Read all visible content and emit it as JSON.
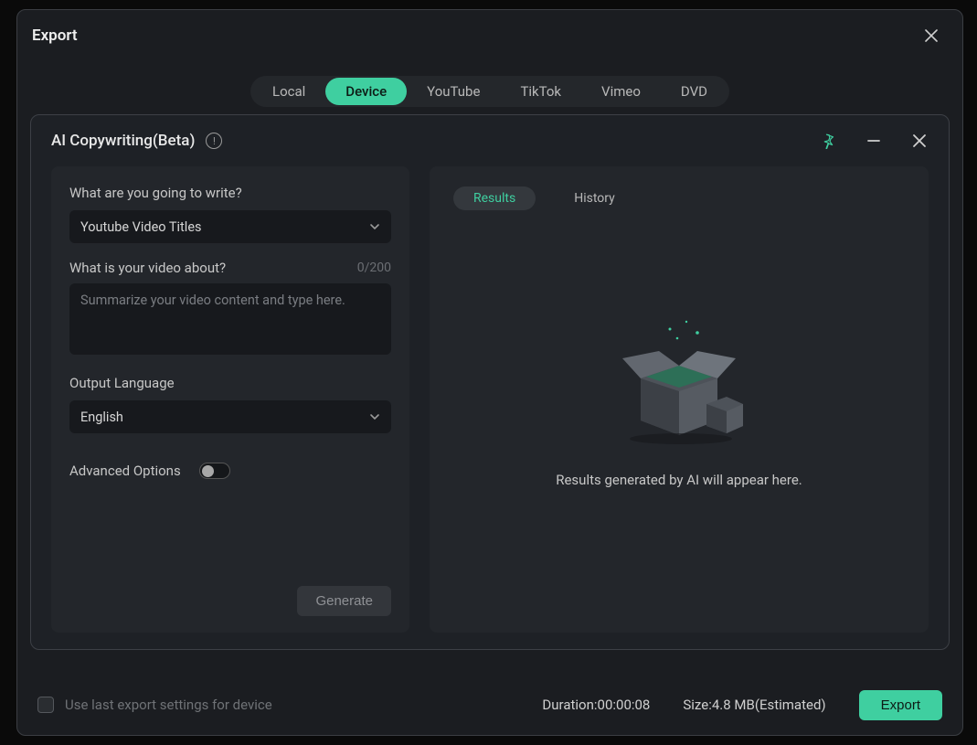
{
  "outer": {
    "title": "Export",
    "tabs": [
      "Local",
      "Device",
      "YouTube",
      "TikTok",
      "Vimeo",
      "DVD"
    ],
    "active_tab": "Device"
  },
  "inner": {
    "title": "AI Copywriting(Beta)"
  },
  "form": {
    "write_label": "What are you going to write?",
    "write_value": "Youtube Video Titles",
    "about_label": "What is your video about?",
    "about_counter": "0/200",
    "about_placeholder": "Summarize your video content and type here.",
    "lang_label": "Output Language",
    "lang_value": "English",
    "advanced_label": "Advanced Options",
    "generate_label": "Generate"
  },
  "results": {
    "tab_results": "Results",
    "tab_history": "History",
    "empty_text": "Results generated by AI will appear here."
  },
  "footer": {
    "checkbox_label": "Use last export settings for device",
    "duration_label": "Duration:",
    "duration_value": "00:00:08",
    "size_label": "Size:",
    "size_value": "4.8 MB(Estimated)",
    "export_label": "Export"
  },
  "colors": {
    "accent": "#3fcfa0"
  }
}
